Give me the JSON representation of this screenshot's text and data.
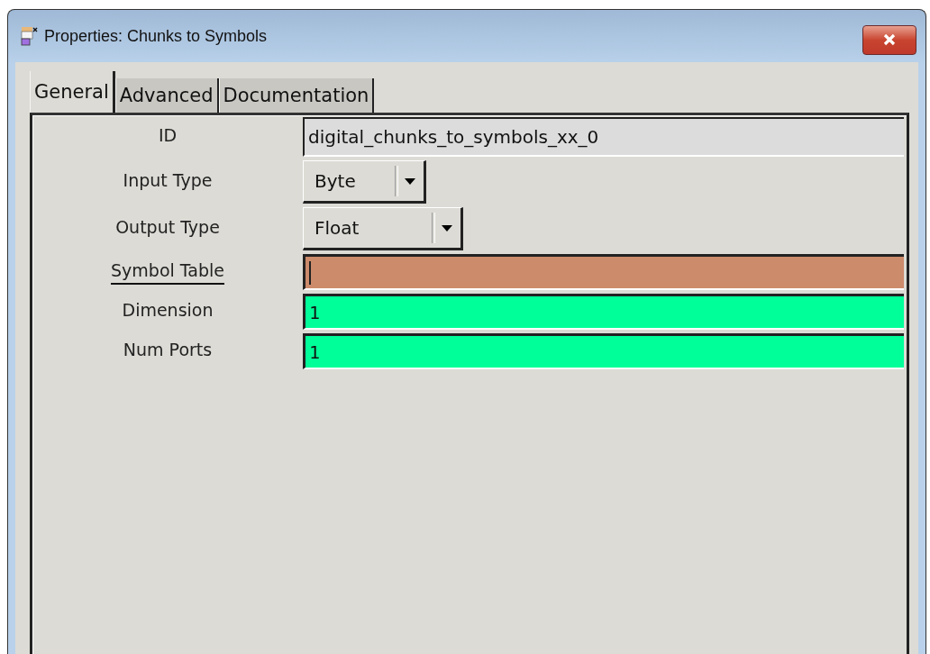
{
  "window": {
    "title": "Properties: Chunks to Symbols"
  },
  "tabs": [
    {
      "label": "General",
      "selected": true
    },
    {
      "label": "Advanced",
      "selected": false
    },
    {
      "label": "Documentation",
      "selected": false
    }
  ],
  "params": [
    {
      "label": "ID",
      "kind": "text",
      "value": "digital_chunks_to_symbols_xx_0",
      "color": "#dcdcdc",
      "underlined": false,
      "focused": false
    },
    {
      "label": "Input Type",
      "kind": "combo",
      "value": "Byte",
      "underlined": false
    },
    {
      "label": "Output Type",
      "kind": "combo",
      "value": "Float",
      "underlined": false
    },
    {
      "label": "Symbol Table",
      "kind": "entry",
      "color": "#cc8b6b",
      "underlined": true,
      "focused": true
    },
    {
      "label": "Dimension",
      "kind": "entry",
      "value": "1",
      "color": "#00ff99",
      "underlined": false,
      "focused": false
    },
    {
      "label": "Num Ports",
      "kind": "entry",
      "value": "1",
      "color": "#00ff99",
      "underlined": false,
      "focused": false
    }
  ]
}
